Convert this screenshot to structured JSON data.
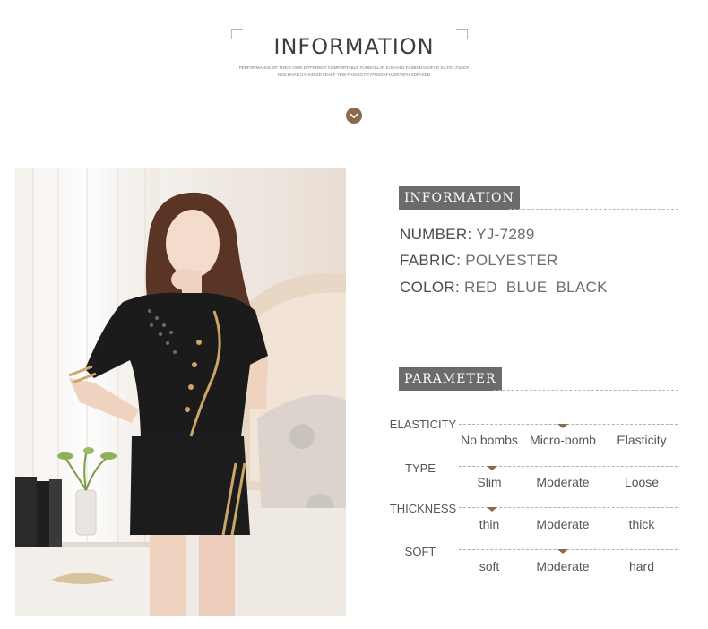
{
  "header": {
    "title": "INFORMATION",
    "subtitle_line1": "PERFORMANCE OF THEIR OWN DIFFERENT COMFORTABLE FUNDHSLAF SI DHALD FASBNDASDFHD SA FDL FSADF",
    "subtitle_line2": "NDS DHAD UYHAN SD FEALF YEW F HOSO FEYFHSDAFHJDFASFH SDFASDB",
    "chevron_icon": "chevron-down-icon"
  },
  "info": {
    "label": "INFORMATION",
    "rows": [
      {
        "key": "NUMBER:",
        "value": "YJ-7289"
      },
      {
        "key": "FABRIC:",
        "value": "POLYESTER"
      },
      {
        "key": "COLOR:",
        "value": "RED  BLUE  BLACK"
      }
    ]
  },
  "parameter": {
    "label": "PARAMETER",
    "rows": [
      {
        "name": "ELASTICITY",
        "options": [
          "No bombs",
          "Micro-bomb",
          "Elasticity"
        ],
        "selected": 1
      },
      {
        "name": "TYPE",
        "options": [
          "Slim",
          "Moderate",
          "Loose"
        ],
        "selected": 0
      },
      {
        "name": "THICKNESS",
        "options": [
          "thin",
          "Moderate",
          "thick"
        ],
        "selected": 0
      },
      {
        "name": "SOFT",
        "options": [
          "soft",
          "Moderate",
          "hard"
        ],
        "selected": 1
      }
    ]
  },
  "colors": {
    "accent": "#8a6a4f",
    "label_bg": "#6b6b6b",
    "photo_outfit": "#1b1b1b",
    "trim_gold": "#c9a86a"
  }
}
